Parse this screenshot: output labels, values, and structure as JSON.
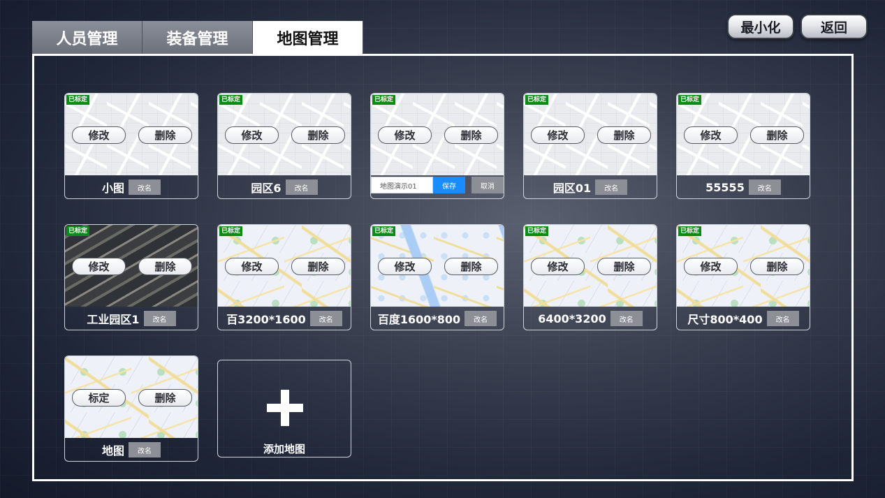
{
  "tabs": [
    {
      "label": "人员管理",
      "active": false
    },
    {
      "label": "装备管理",
      "active": false
    },
    {
      "label": "地图管理",
      "active": true
    }
  ],
  "top_buttons": {
    "minimize": "最小化",
    "back": "返回"
  },
  "common": {
    "calibrated_badge": "已标定",
    "edit": "修改",
    "delete": "删除",
    "calibrate": "标定",
    "rename": "改名"
  },
  "maps": [
    {
      "name": "小图",
      "calibrated": true,
      "style": "grey"
    },
    {
      "name": "园区6",
      "calibrated": true,
      "style": "grey"
    },
    {
      "name": "",
      "calibrated": true,
      "style": "grey",
      "editing": true
    },
    {
      "name": "园区01",
      "calibrated": true,
      "style": "grey"
    },
    {
      "name": "55555",
      "calibrated": true,
      "style": "grey"
    },
    {
      "name": "工业园区1",
      "calibrated": true,
      "style": "satellite"
    },
    {
      "name": "百3200*1600",
      "calibrated": true,
      "style": "light"
    },
    {
      "name": "百度1600*800",
      "calibrated": true,
      "style": "river"
    },
    {
      "name": "6400*3200",
      "calibrated": true,
      "style": "light"
    },
    {
      "name": "尺寸800*400",
      "calibrated": true,
      "style": "light"
    },
    {
      "name": "地图",
      "calibrated": false,
      "style": "light"
    }
  ],
  "rename_edit": {
    "value": "地图演示01",
    "save": "保存",
    "cancel": "取消"
  },
  "add_map": {
    "label": "添加地图"
  }
}
